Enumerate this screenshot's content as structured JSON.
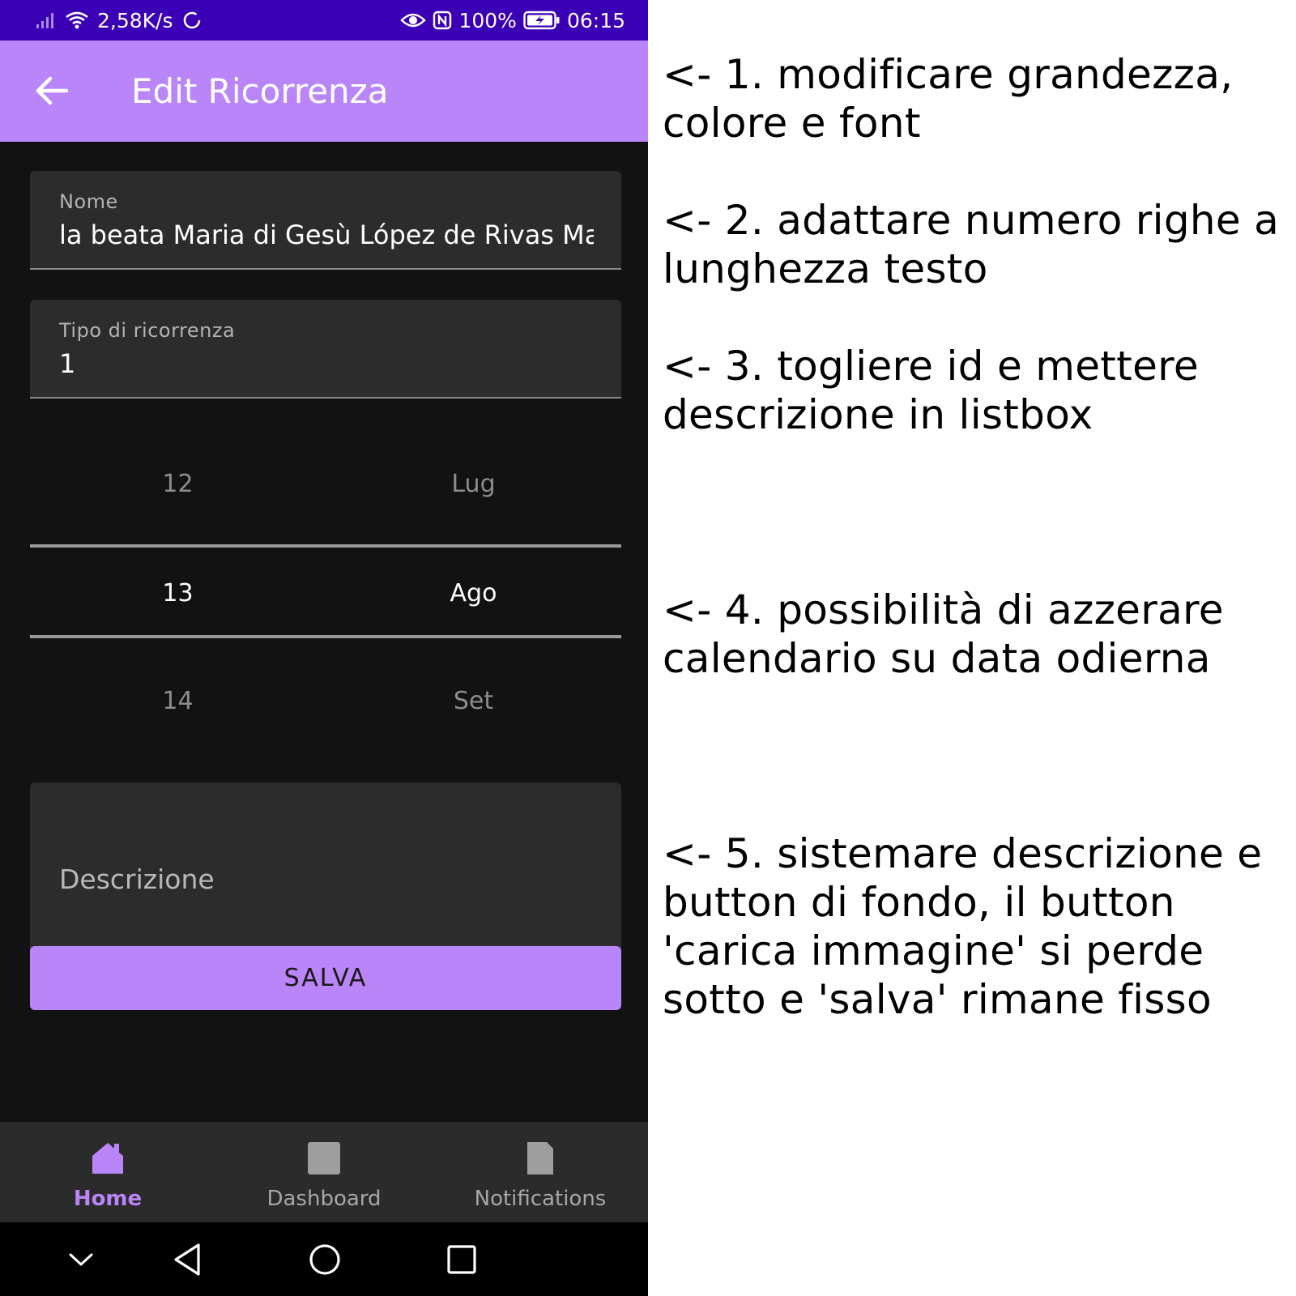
{
  "status_bar": {
    "net_speed": "2,58K/s",
    "battery": "100%",
    "time": "06:15",
    "icons": [
      "signal-icon",
      "wifi-icon",
      "sync-icon",
      "eye-icon",
      "nfc-icon",
      "battery-icon"
    ]
  },
  "app_bar": {
    "title": "Edit Ricorrenza",
    "back_icon": "arrow-left-icon"
  },
  "form": {
    "nome": {
      "label": "Nome",
      "value": "la beata Maria di Gesù López de Rivas Ma"
    },
    "tipo": {
      "label": "Tipo di ricorrenza",
      "value": "1"
    },
    "picker": {
      "days": [
        "12",
        "13",
        "14"
      ],
      "months": [
        "Lug",
        "Ago",
        "Set"
      ],
      "selected_index": 1
    },
    "descrizione": {
      "placeholder": "Descrizione"
    },
    "save_label": "SALVA"
  },
  "bottom_nav": {
    "items": [
      {
        "label": "Home",
        "icon": "home-icon",
        "active": true
      },
      {
        "label": "Dashboard",
        "icon": "dashboard-icon",
        "active": false
      },
      {
        "label": "Notifications",
        "icon": "notifications-icon",
        "active": false
      }
    ]
  },
  "system_nav": [
    "chevron-down-icon",
    "back-triangle-icon",
    "home-circle-icon",
    "recents-square-icon"
  ],
  "annotations": [
    "<- 1. modificare grandezza, colore e font",
    "<- 2. adattare numero righe a lunghezza testo",
    "<- 3. togliere id e mettere descrizione in listbox",
    "<- 4. possibilità di azzerare calendario su data odierna",
    "<- 5. sistemare descrizione e button di fondo, il button 'carica immagine' si perde sotto e 'salva' rimane fisso"
  ],
  "colors": {
    "status_bar": "#3b00b6",
    "accent": "#b985f9",
    "background": "#121212",
    "field": "#2c2c2c",
    "nav_bar": "#2b2b2b"
  }
}
